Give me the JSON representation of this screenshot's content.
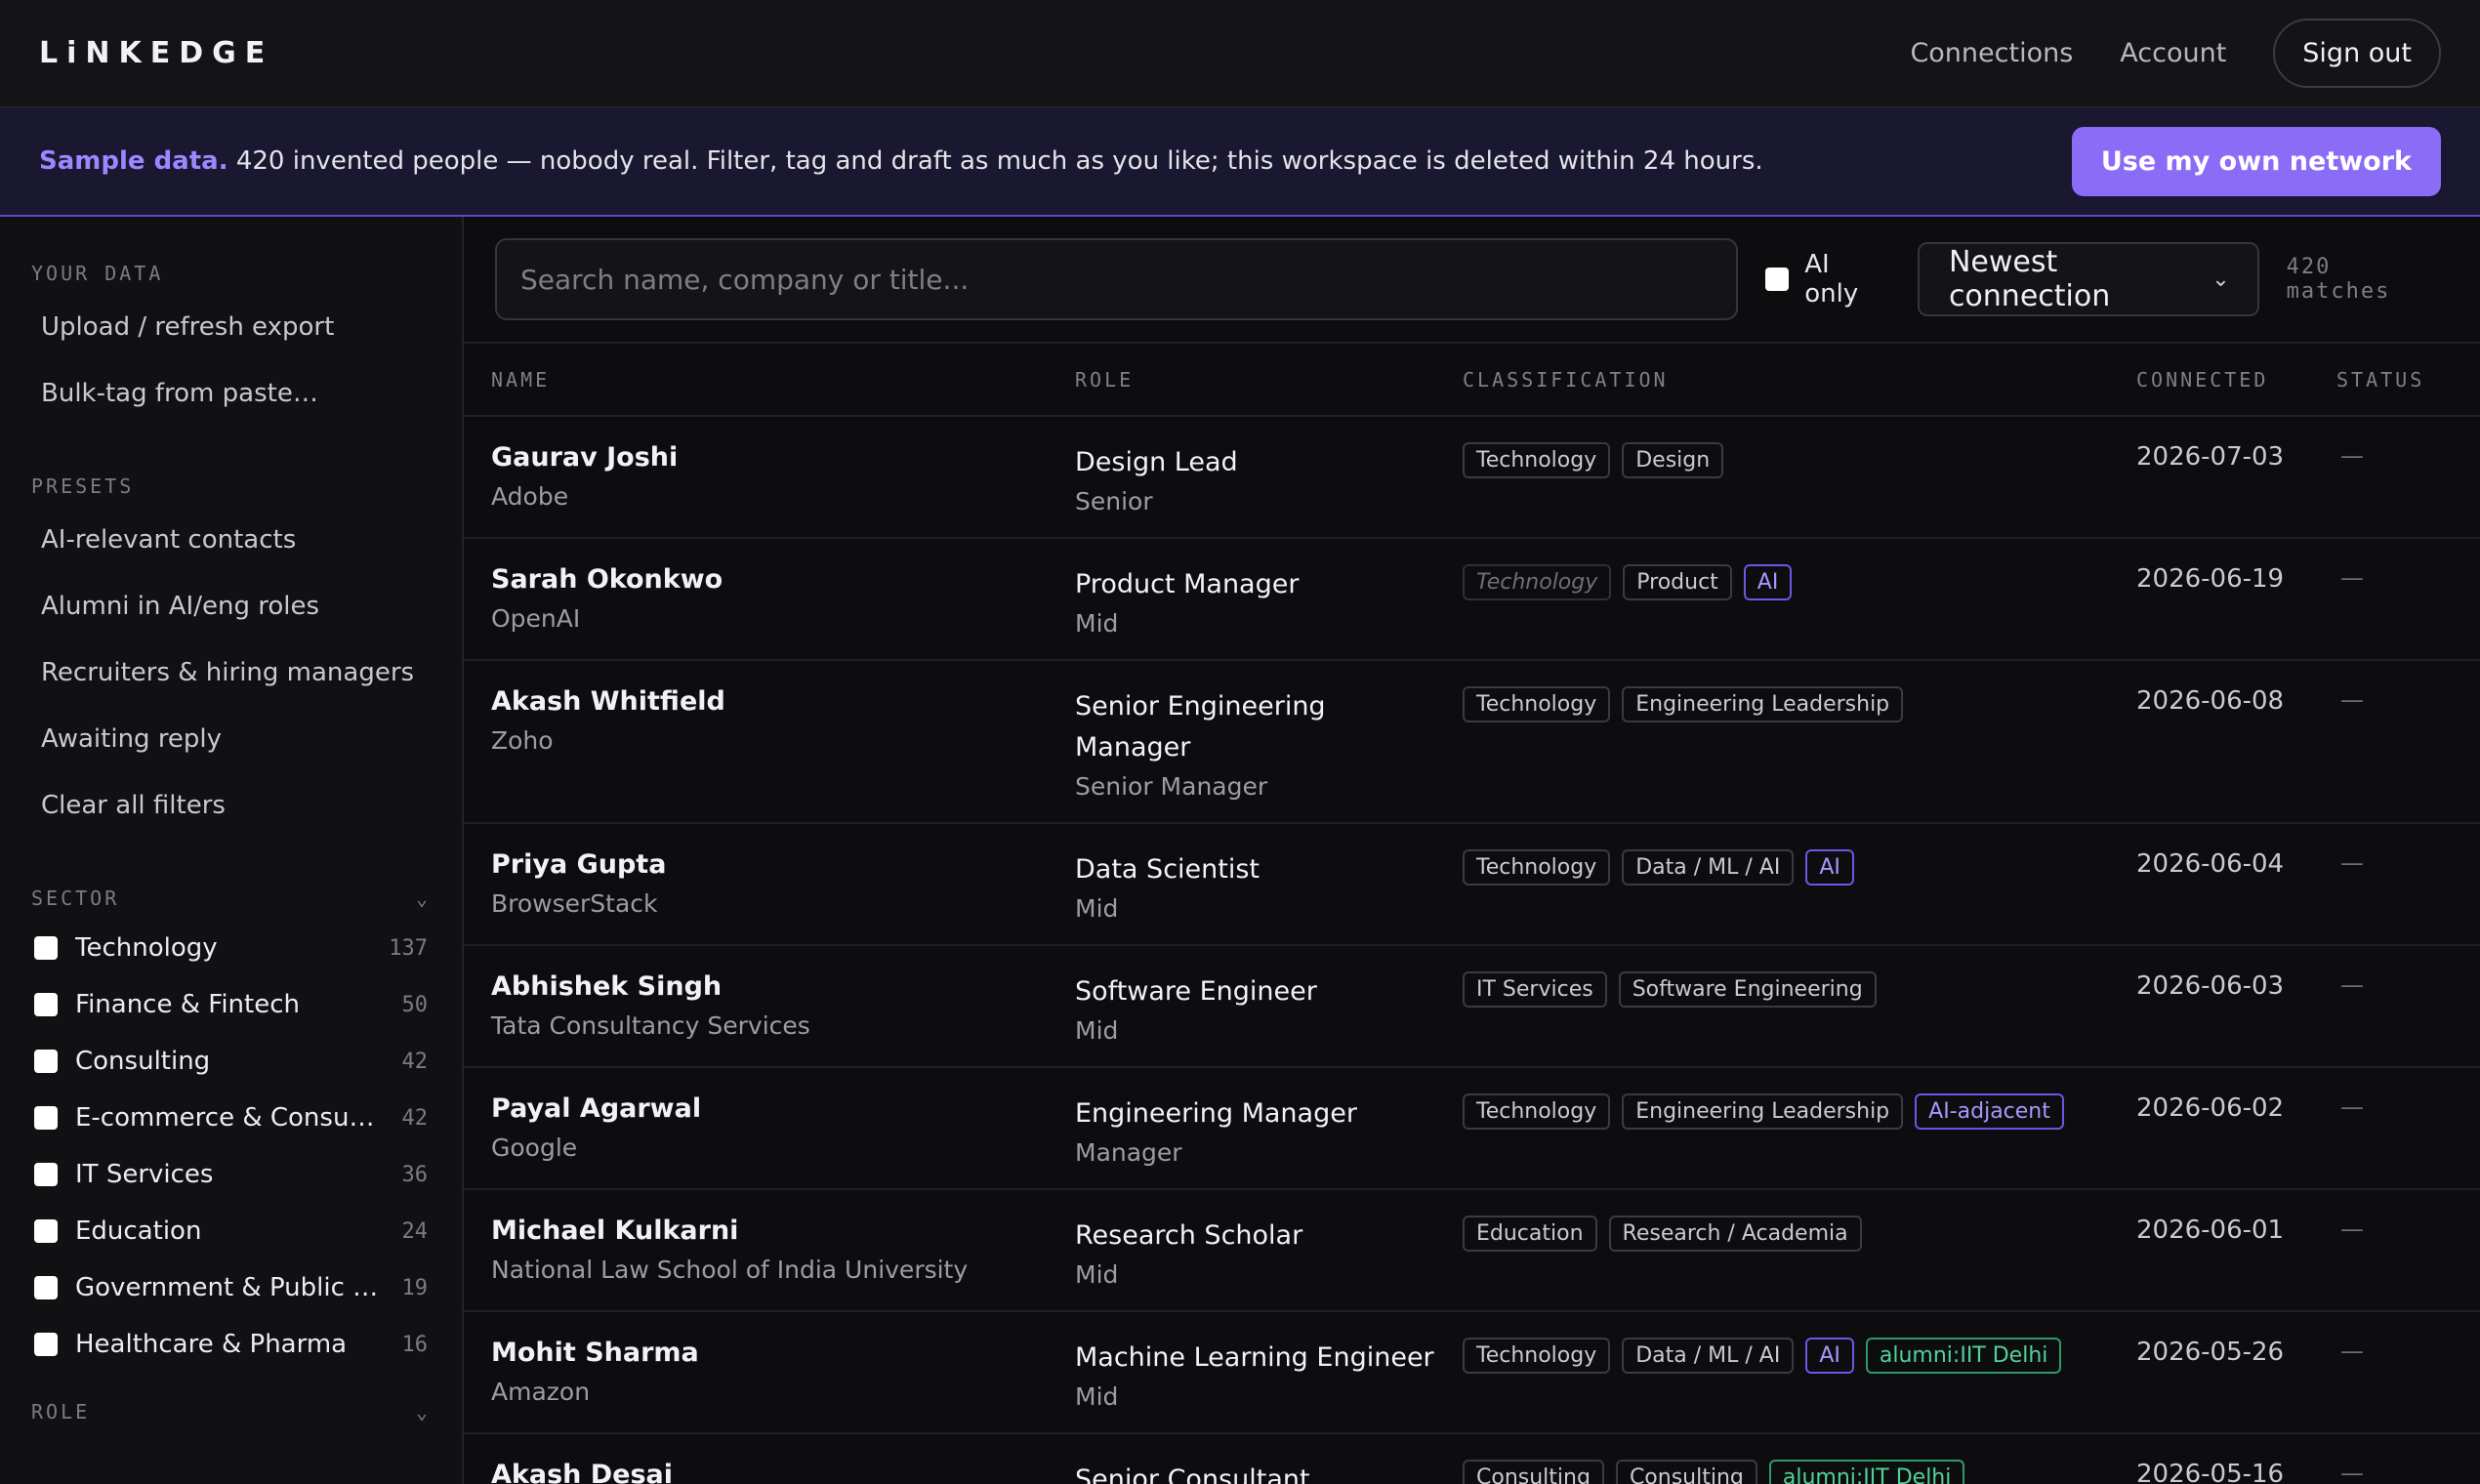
{
  "header": {
    "brand": "LiNKEDGE",
    "nav": [
      "Connections",
      "Account"
    ],
    "signout": "Sign out"
  },
  "banner": {
    "strong": "Sample data.",
    "text": " 420 invented people — nobody real. Filter, tag and draft as much as you like; this workspace is deleted within 24 hours.",
    "cta": "Use my own network"
  },
  "sidebar": {
    "your_data_label": "YOUR DATA",
    "your_data": [
      "Upload / refresh export",
      "Bulk-tag from paste…"
    ],
    "presets_label": "PRESETS",
    "presets": [
      "AI-relevant contacts",
      "Alumni in AI/eng roles",
      "Recruiters & hiring managers",
      "Awaiting reply",
      "Clear all filters"
    ],
    "sector_label": "SECTOR",
    "sectors": [
      {
        "label": "Technology",
        "count": "137"
      },
      {
        "label": "Finance & Fintech",
        "count": "50"
      },
      {
        "label": "Consulting",
        "count": "42"
      },
      {
        "label": "E-commerce & Consumer",
        "count": "42"
      },
      {
        "label": "IT Services",
        "count": "36"
      },
      {
        "label": "Education",
        "count": "24"
      },
      {
        "label": "Government & Public Se...",
        "count": "19"
      },
      {
        "label": "Healthcare & Pharma",
        "count": "16"
      }
    ],
    "role_label": "ROLE"
  },
  "toolbar": {
    "search_placeholder": "Search name, company or title...",
    "ai_only": "AI only",
    "sort": "Newest connection",
    "matches": "420 matches"
  },
  "table": {
    "headers": [
      "NAME",
      "ROLE",
      "CLASSIFICATION",
      "CONNECTED",
      "STATUS"
    ],
    "rows": [
      {
        "name": "Gaurav Joshi",
        "company": "Adobe",
        "title": "Design Lead",
        "level": "Senior",
        "tags": [
          {
            "t": "Technology",
            "k": "plain"
          },
          {
            "t": "Design",
            "k": "plain"
          }
        ],
        "date": "2026-07-03",
        "status": "—"
      },
      {
        "name": "Sarah Okonkwo",
        "company": "OpenAI",
        "title": "Product Manager",
        "level": "Mid",
        "tags": [
          {
            "t": "Technology",
            "k": "faint"
          },
          {
            "t": "Product",
            "k": "plain"
          },
          {
            "t": "AI",
            "k": "ai"
          }
        ],
        "date": "2026-06-19",
        "status": "—"
      },
      {
        "name": "Akash Whitfield",
        "company": "Zoho",
        "title": "Senior Engineering Manager",
        "level": "Senior Manager",
        "tags": [
          {
            "t": "Technology",
            "k": "plain"
          },
          {
            "t": "Engineering Leadership",
            "k": "plain"
          }
        ],
        "date": "2026-06-08",
        "status": "—"
      },
      {
        "name": "Priya Gupta",
        "company": "BrowserStack",
        "title": "Data Scientist",
        "level": "Mid",
        "tags": [
          {
            "t": "Technology",
            "k": "plain"
          },
          {
            "t": "Data / ML / AI",
            "k": "plain"
          },
          {
            "t": "AI",
            "k": "ai"
          }
        ],
        "date": "2026-06-04",
        "status": "—"
      },
      {
        "name": "Abhishek Singh",
        "company": "Tata Consultancy Services",
        "title": "Software Engineer",
        "level": "Mid",
        "tags": [
          {
            "t": "IT Services",
            "k": "plain"
          },
          {
            "t": "Software Engineering",
            "k": "plain"
          }
        ],
        "date": "2026-06-03",
        "status": "—"
      },
      {
        "name": "Payal Agarwal",
        "company": "Google",
        "title": "Engineering Manager",
        "level": "Manager",
        "tags": [
          {
            "t": "Technology",
            "k": "plain"
          },
          {
            "t": "Engineering Leadership",
            "k": "plain"
          },
          {
            "t": "AI-adjacent",
            "k": "ai"
          }
        ],
        "date": "2026-06-02",
        "status": "—"
      },
      {
        "name": "Michael Kulkarni",
        "company": "National Law School of India University",
        "title": "Research Scholar",
        "level": "Mid",
        "tags": [
          {
            "t": "Education",
            "k": "plain"
          },
          {
            "t": "Research / Academia",
            "k": "plain"
          }
        ],
        "date": "2026-06-01",
        "status": "—"
      },
      {
        "name": "Mohit Sharma",
        "company": "Amazon",
        "title": "Machine Learning Engineer",
        "level": "Mid",
        "tags": [
          {
            "t": "Technology",
            "k": "plain"
          },
          {
            "t": "Data / ML / AI",
            "k": "plain"
          },
          {
            "t": "AI",
            "k": "ai"
          },
          {
            "t": "alumni:IIT Delhi",
            "k": "alumni"
          }
        ],
        "date": "2026-05-26",
        "status": "—"
      },
      {
        "name": "Akash Desai",
        "company": "",
        "title": "Senior Consultant",
        "level": "",
        "tags": [
          {
            "t": "Consulting",
            "k": "plain"
          },
          {
            "t": "Consulting",
            "k": "plain"
          },
          {
            "t": "alumni:IIT Delhi",
            "k": "alumni"
          }
        ],
        "date": "2026-05-16",
        "status": "—"
      }
    ]
  }
}
